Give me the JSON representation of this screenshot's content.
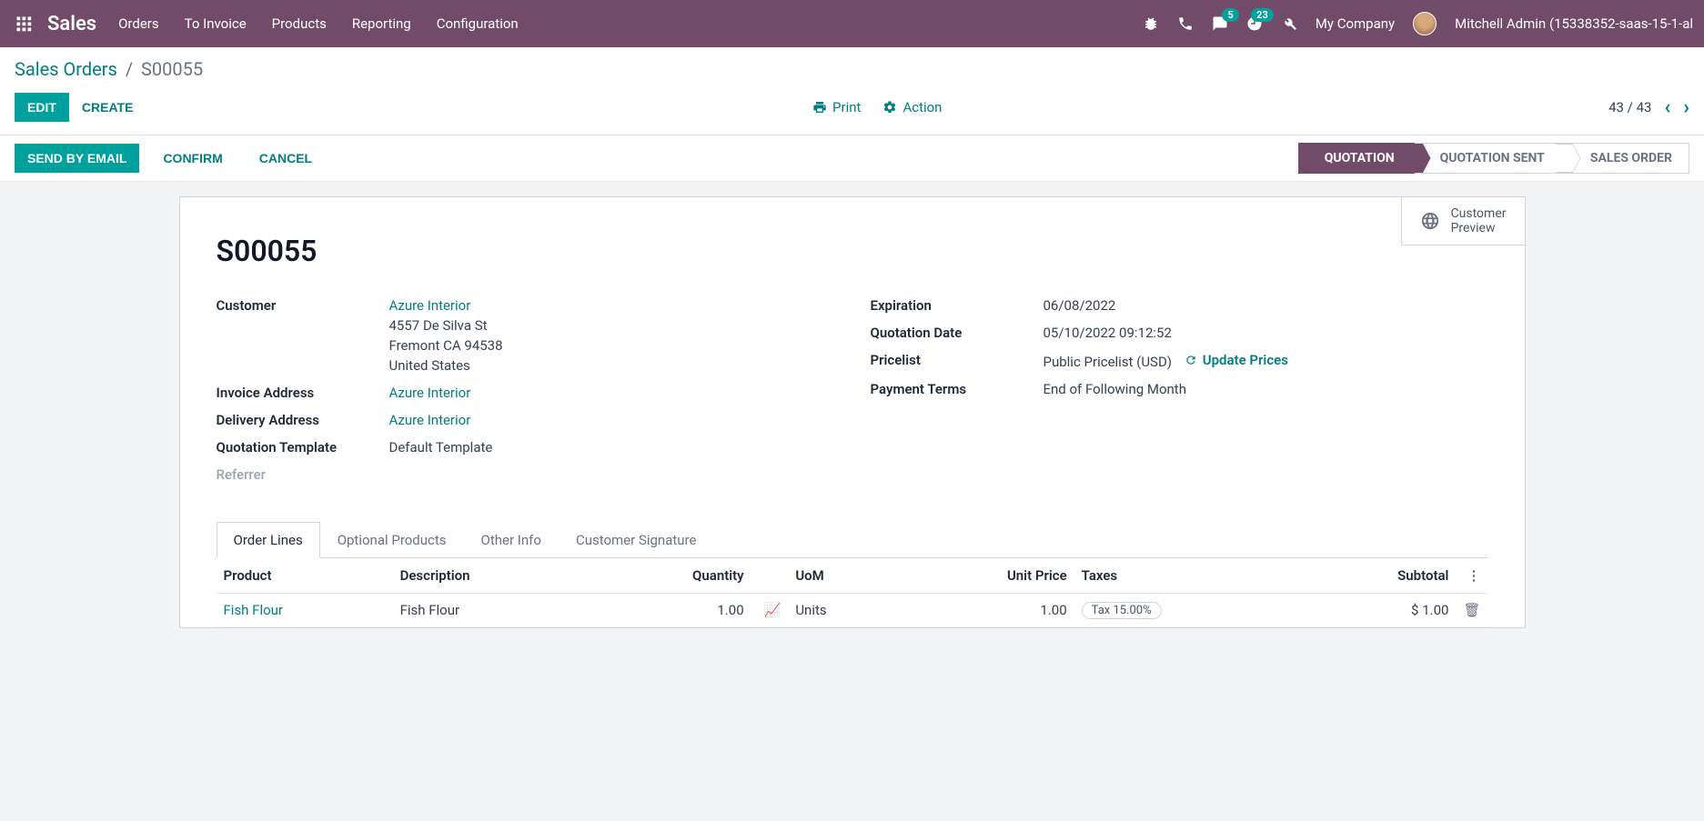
{
  "topbar": {
    "brand": "Sales",
    "nav": [
      "Orders",
      "To Invoice",
      "Products",
      "Reporting",
      "Configuration"
    ],
    "msg_badge": "5",
    "activity_badge": "23",
    "company": "My Company",
    "user": "Mitchell Admin (15338352-saas-15-1-al"
  },
  "breadcrumb": {
    "root": "Sales Orders",
    "current": "S00055"
  },
  "ctrl": {
    "edit": "EDIT",
    "create": "CREATE",
    "print": "Print",
    "action": "Action",
    "pager": "43 / 43"
  },
  "status_actions": {
    "send": "SEND BY EMAIL",
    "confirm": "CONFIRM",
    "cancel": "CANCEL"
  },
  "stages": [
    "QUOTATION",
    "QUOTATION SENT",
    "SALES ORDER"
  ],
  "preview": {
    "line1": "Customer",
    "line2": "Preview"
  },
  "doc": {
    "title": "S00055",
    "left_labels": {
      "customer": "Customer",
      "invoice": "Invoice Address",
      "delivery": "Delivery Address",
      "template": "Quotation Template",
      "referrer": "Referrer"
    },
    "right_labels": {
      "expiration": "Expiration",
      "qdate": "Quotation Date",
      "pricelist": "Pricelist",
      "payment": "Payment Terms"
    },
    "customer": {
      "name": "Azure Interior",
      "addr1": "4557 De Silva St",
      "addr2": "Fremont CA 94538",
      "addr3": "United States"
    },
    "invoice_address": "Azure Interior",
    "delivery_address": "Azure Interior",
    "template": "Default Template",
    "expiration": "06/08/2022",
    "quotation_date": "05/10/2022 09:12:52",
    "pricelist": "Public Pricelist (USD)",
    "update_prices": "Update Prices",
    "payment_terms": "End of Following Month"
  },
  "tabs": [
    "Order Lines",
    "Optional Products",
    "Other Info",
    "Customer Signature"
  ],
  "table": {
    "headers": {
      "product": "Product",
      "description": "Description",
      "quantity": "Quantity",
      "uom": "UoM",
      "unit_price": "Unit Price",
      "taxes": "Taxes",
      "subtotal": "Subtotal"
    },
    "row": {
      "product": "Fish Flour",
      "description": "Fish Flour",
      "quantity": "1.00",
      "uom": "Units",
      "unit_price": "1.00",
      "tax": "Tax 15.00%",
      "subtotal": "$ 1.00"
    }
  }
}
